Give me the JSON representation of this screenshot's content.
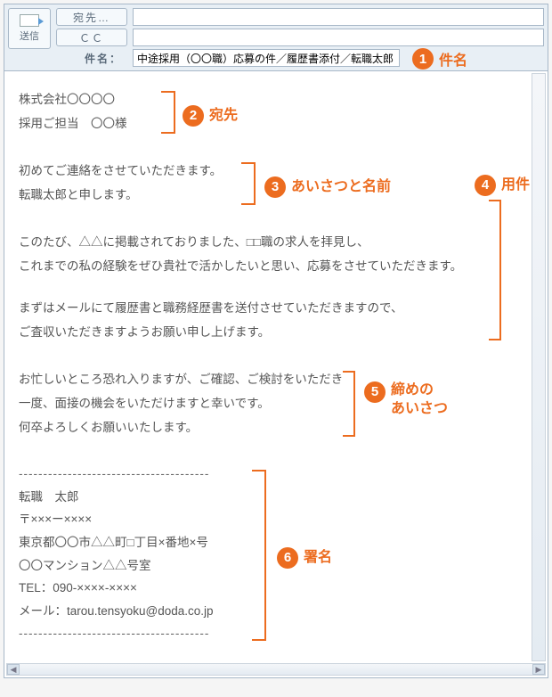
{
  "header": {
    "send_label": "送信",
    "to_button": "宛先…",
    "cc_button": "ＣＣ",
    "subject_label": "件名：",
    "to_value": "",
    "cc_value": "",
    "subject_value": "中途採用（〇〇職）応募の件／履歴書添付／転職太郎"
  },
  "body": {
    "addr_company": "株式会社〇〇〇〇",
    "addr_person": "採用ご担当　〇〇様",
    "greet_1": "初めてご連絡をさせていただきます。",
    "greet_2": "転職太郎と申します。",
    "purpose_1": "このたび、△△に掲載されておりました、□□職の求人を拝見し、",
    "purpose_2": "これまでの私の経験をぜひ貴社で活かしたいと思い、応募をさせていただきます。",
    "purpose_3": "まずはメールにて履歴書と職務経歴書を送付させていただきますので、",
    "purpose_4": "ご査収いただきますようお願い申し上げます。",
    "close_1": "お忙しいところ恐れ入りますが、ご確認、ご検討をいただき",
    "close_2": "一度、面接の機会をいただけますと幸いです。",
    "close_3": "何卒よろしくお願いいたします。",
    "sig_divider": "---------------------------------------",
    "sig_name": "転職　太郎",
    "sig_zip": "〒×××ー××××",
    "sig_addr1": "東京都〇〇市△△町□丁目×番地×号",
    "sig_addr2": "〇〇マンション△△号室",
    "sig_tel": "TEL：090-××××-××××",
    "sig_mail": "メール：tarou.tensyoku@doda.co.jp"
  },
  "annotations": {
    "a1": "件名",
    "a2": "宛先",
    "a3": "あいさつと名前",
    "a4": "用件",
    "a5_1": "締めの",
    "a5_2": "あいさつ",
    "a6": "署名"
  }
}
